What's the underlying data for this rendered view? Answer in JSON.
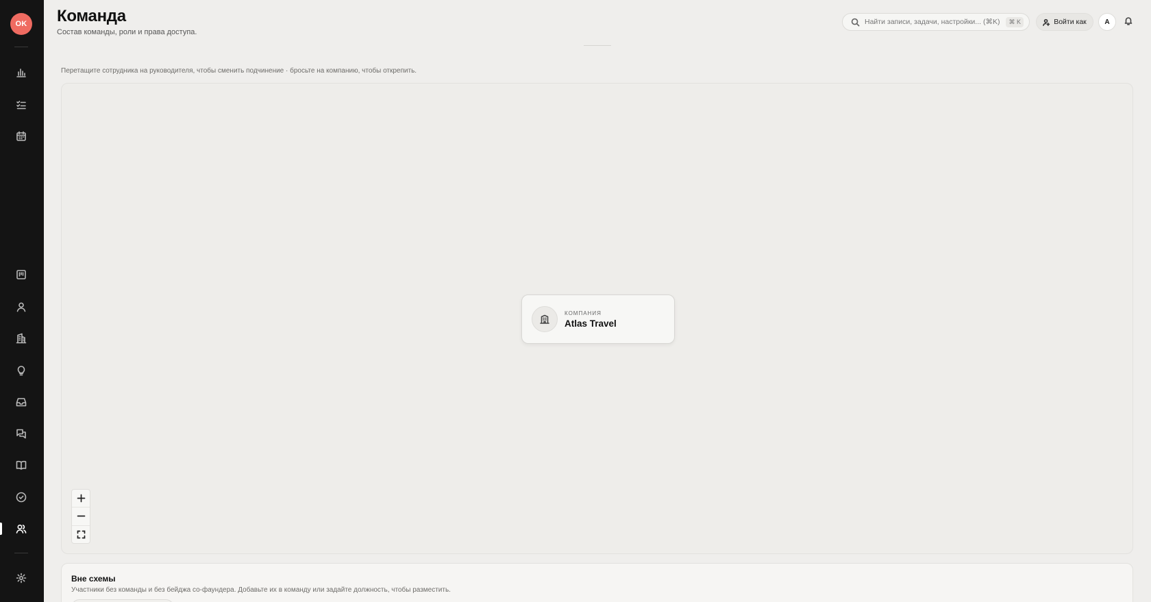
{
  "sidebar": {
    "avatar_initials": "OK",
    "icons": [
      "chart-icon",
      "tasks-icon",
      "calendar-icon",
      "board-icon",
      "user-icon",
      "building-icon",
      "lightbulb-icon",
      "inbox-icon",
      "chat-icon",
      "book-icon",
      "check-circle-icon",
      "team-icon",
      "settings-icon"
    ],
    "active": "team-icon"
  },
  "header": {
    "title": "Команда",
    "subtitle": "Состав команды, роли и права доступа.",
    "search_placeholder": "Найти записи, задачи, настройки... (⌘K)",
    "search_shortcut": "⌘ K",
    "login_as_label": "Войти как",
    "user_initial": "A"
  },
  "main": {
    "hint": "Перетащите сотрудника на руководителя, чтобы сменить подчинение · бросьте на компанию, чтобы открепить.",
    "company_card": {
      "kind": "Компания",
      "name": "Atlas Travel"
    },
    "zoom_controls": [
      "zoom-in",
      "zoom-out",
      "fit-view"
    ]
  },
  "off_scheme": {
    "title": "Вне схемы",
    "description": "Участники без команды и без бейджа со-фаундера. Добавьте их в команду или задайте должность, чтобы разместить."
  }
}
